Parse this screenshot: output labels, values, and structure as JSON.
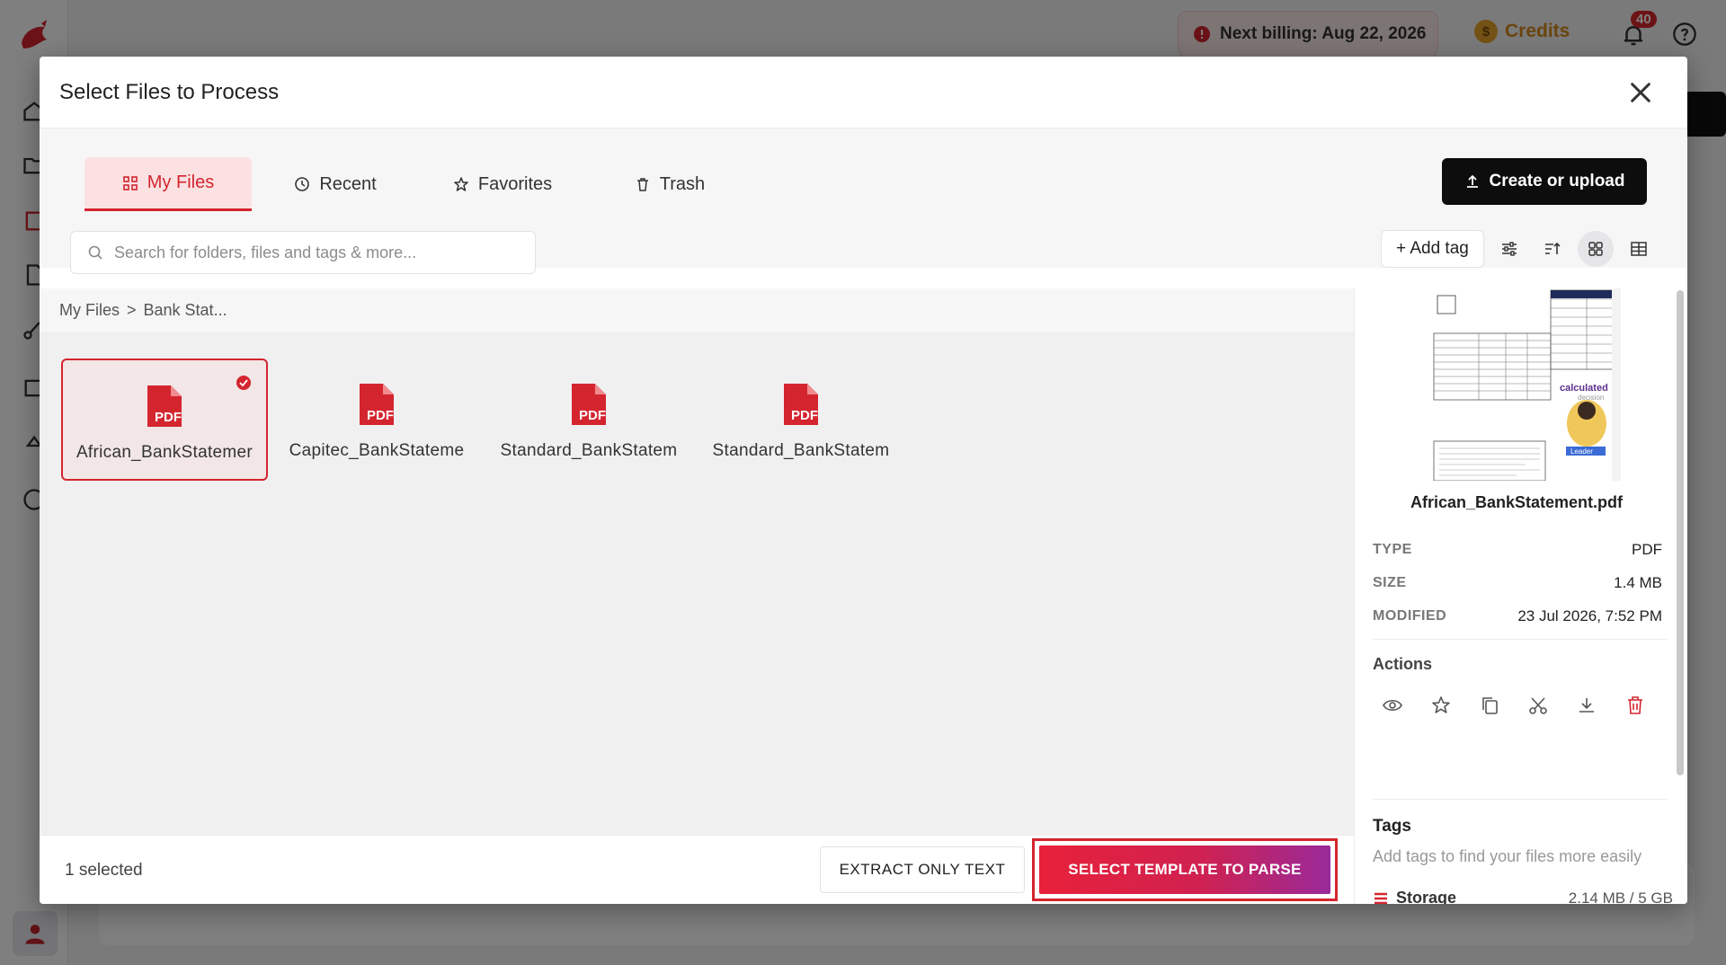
{
  "app": {
    "billing_text": "Next billing: Aug 22, 2026",
    "credits_label": "Credits",
    "notification_count": "40",
    "coin_symbol": "$"
  },
  "modal": {
    "title": "Select Files to Process",
    "tabs": [
      {
        "label": "My Files",
        "icon": "grid-icon",
        "active": true
      },
      {
        "label": "Recent",
        "icon": "clock-icon",
        "active": false
      },
      {
        "label": "Favorites",
        "icon": "star-icon",
        "active": false
      },
      {
        "label": "Trash",
        "icon": "trash-icon",
        "active": false
      }
    ],
    "upload_label": "Create or upload",
    "search_placeholder": "Search for folders, files and tags & more...",
    "add_tag_label": "+ Add tag",
    "breadcrumb": [
      "My Files",
      "Bank Stat..."
    ],
    "breadcrumb_sep": ">",
    "files": [
      {
        "name": "African_BankStatement.pdf",
        "display": "African_BankStatemer",
        "selected": true
      },
      {
        "name": "Capitec_BankStatement.pdf",
        "display": "Capitec_BankStateme",
        "selected": false
      },
      {
        "name": "Standard_BankStatement.pdf",
        "display": "Standard_BankStatem",
        "selected": false
      },
      {
        "name": "Standard_BankStatement.pdf",
        "display": "Standard_BankStatem",
        "selected": false
      }
    ],
    "preview": {
      "thumb_text_1": "calculated",
      "thumb_text_2": "decision",
      "thumb_text_3": "Leader",
      "file_name": "African_BankStatement.pdf",
      "meta": [
        {
          "key": "TYPE",
          "value": "PDF"
        },
        {
          "key": "SIZE",
          "value": "1.4 MB"
        },
        {
          "key": "MODIFIED",
          "value": "23 Jul 2026, 7:52 PM"
        }
      ],
      "actions_label": "Actions",
      "tags_label": "Tags",
      "tags_hint": "Add tags to find your files more easily",
      "storage_label": "Storage",
      "storage_value": "2.14 MB / 5 GB"
    },
    "footer": {
      "selected_count": "1 selected",
      "extract_label": "EXTRACT ONLY TEXT",
      "parse_label": "SELECT TEMPLATE TO PARSE"
    }
  },
  "colors": {
    "accent": "#d4252f",
    "parse_gradient_start": "#e8213a",
    "parse_gradient_end": "#9a2a9a"
  }
}
